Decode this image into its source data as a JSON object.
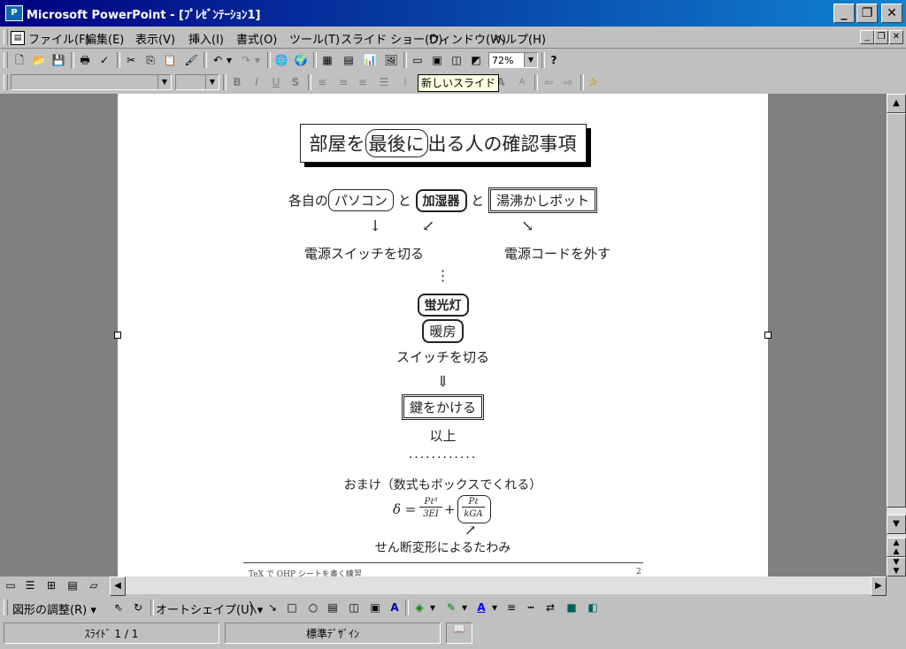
{
  "window": {
    "title": "Microsoft PowerPoint - [ﾌﾟﾚｾﾞﾝﾃｰｼｮﾝ1]",
    "app_icon": "P"
  },
  "menu": [
    "ファイル(F)",
    "編集(E)",
    "表示(V)",
    "挿入(I)",
    "書式(O)",
    "ツール(T)",
    "スライド ショー(D)",
    "ウィンドウ(W)",
    "ヘルプ(H)"
  ],
  "toolbar": {
    "zoom": "72%",
    "tooltip": "新しいスライド"
  },
  "slide": {
    "title_parts": [
      "部屋を",
      "最後に",
      "出る人の確認事項"
    ],
    "row1_prefix": "各自の",
    "device1": "パソコン",
    "conj1": "と",
    "device2": "加湿器",
    "conj2": "と",
    "device3": "湯沸かしポット",
    "arrow_down": "↓",
    "arrow_downleft": "↙",
    "arrow_downright": "↘",
    "action1": "電源スイッチを切る",
    "action2": "電源コードを外す",
    "vdots": "⋮",
    "item_light": "蛍光灯",
    "item_heater": "暖房",
    "action3": "スイッチを切る",
    "arrow_double": "⇓",
    "lock": "鍵をかける",
    "end": "以上",
    "dots": "............",
    "bonus": "おまけ（数式もボックスでくれる）",
    "formula_delta": "δ =",
    "frac1_num": "Pℓ³",
    "frac1_den": "3EI",
    "plus": "+",
    "frac2_num": "Pℓ",
    "frac2_den": "kGA",
    "arrow_upright": "↗",
    "shear_note": "せん断変形によるたわみ",
    "footer_left": "TeX で OHP シートを書く練習",
    "footer_right": "2"
  },
  "drawing_toolbar": {
    "draw_menu": "図形の調整(R)",
    "autoshape_menu": "オートシェイプ(U)"
  },
  "status": {
    "slide": "ｽﾗｲﾄﾞ 1 / 1",
    "design": "標準ﾃﾞｻﾞｲﾝ"
  }
}
